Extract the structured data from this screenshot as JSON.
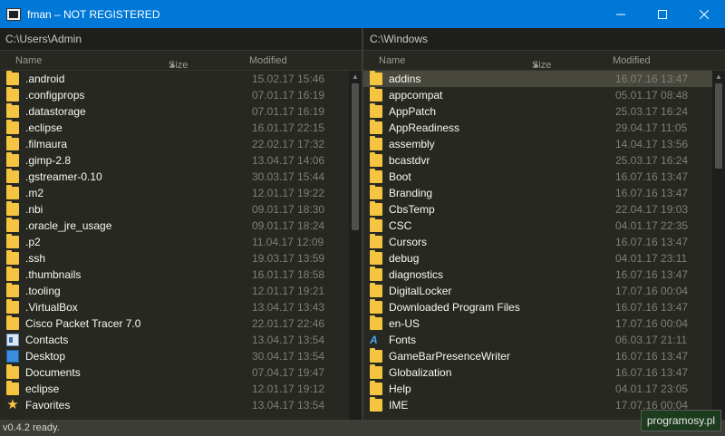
{
  "window": {
    "title": "fman – NOT REGISTERED"
  },
  "left_pane": {
    "path": "C:\\Users\\Admin",
    "columns": {
      "name": "Name",
      "size": "Size",
      "modified": "Modified",
      "sort_indicator": "▲"
    },
    "rows": [
      {
        "name": ".android",
        "modified": "15.02.17 15:46",
        "icon": "folder-icon"
      },
      {
        "name": ".configprops",
        "modified": "07.01.17 16:19",
        "icon": "folder-icon"
      },
      {
        "name": ".datastorage",
        "modified": "07.01.17 16:19",
        "icon": "folder-icon"
      },
      {
        "name": ".eclipse",
        "modified": "16.01.17 22:15",
        "icon": "folder-icon"
      },
      {
        "name": ".filmaura",
        "modified": "22.02.17 17:32",
        "icon": "folder-icon"
      },
      {
        "name": ".gimp-2.8",
        "modified": "13.04.17 14:06",
        "icon": "folder-icon"
      },
      {
        "name": ".gstreamer-0.10",
        "modified": "30.03.17 15:44",
        "icon": "folder-icon"
      },
      {
        "name": ".m2",
        "modified": "12.01.17 19:22",
        "icon": "folder-icon"
      },
      {
        "name": ".nbi",
        "modified": "09.01.17 18:30",
        "icon": "folder-icon"
      },
      {
        "name": ".oracle_jre_usage",
        "modified": "09.01.17 18:24",
        "icon": "folder-icon"
      },
      {
        "name": ".p2",
        "modified": "11.04.17 12:09",
        "icon": "folder-icon"
      },
      {
        "name": ".ssh",
        "modified": "19.03.17 13:59",
        "icon": "folder-icon"
      },
      {
        "name": ".thumbnails",
        "modified": "16.01.17 18:58",
        "icon": "folder-icon"
      },
      {
        "name": ".tooling",
        "modified": "12.01.17 19:21",
        "icon": "folder-icon"
      },
      {
        "name": ".VirtualBox",
        "modified": "13.04.17 13:43",
        "icon": "folder-icon"
      },
      {
        "name": "Cisco Packet Tracer 7.0",
        "modified": "22.01.17 22:46",
        "icon": "folder-icon"
      },
      {
        "name": "Contacts",
        "modified": "13.04.17 13:54",
        "icon": "contacts-icon"
      },
      {
        "name": "Desktop",
        "modified": "30.04.17 13:54",
        "icon": "desktop-icon"
      },
      {
        "name": "Documents",
        "modified": "07.04.17 19:47",
        "icon": "folder-icon"
      },
      {
        "name": "eclipse",
        "modified": "12.01.17 19:12",
        "icon": "folder-icon"
      },
      {
        "name": "Favorites",
        "modified": "13.04.17 13:54",
        "icon": "star-icon"
      }
    ]
  },
  "right_pane": {
    "path": "C:\\Windows",
    "columns": {
      "name": "Name",
      "size": "Size",
      "modified": "Modified",
      "sort_indicator": "▲"
    },
    "selected_row": 0,
    "rows": [
      {
        "name": "addins",
        "modified": "16.07.16 13:47",
        "icon": "folder-icon"
      },
      {
        "name": "appcompat",
        "modified": "05.01.17 08:48",
        "icon": "folder-icon"
      },
      {
        "name": "AppPatch",
        "modified": "25.03.17 16:24",
        "icon": "folder-icon"
      },
      {
        "name": "AppReadiness",
        "modified": "29.04.17 11:05",
        "icon": "folder-icon"
      },
      {
        "name": "assembly",
        "modified": "14.04.17 13:56",
        "icon": "folder-icon"
      },
      {
        "name": "bcastdvr",
        "modified": "25.03.17 16:24",
        "icon": "folder-icon"
      },
      {
        "name": "Boot",
        "modified": "16.07.16 13:47",
        "icon": "folder-icon"
      },
      {
        "name": "Branding",
        "modified": "16.07.16 13:47",
        "icon": "folder-icon"
      },
      {
        "name": "CbsTemp",
        "modified": "22.04.17 19:03",
        "icon": "folder-icon"
      },
      {
        "name": "CSC",
        "modified": "04.01.17 22:35",
        "icon": "folder-icon"
      },
      {
        "name": "Cursors",
        "modified": "16.07.16 13:47",
        "icon": "folder-icon"
      },
      {
        "name": "debug",
        "modified": "04.01.17 23:11",
        "icon": "folder-icon"
      },
      {
        "name": "diagnostics",
        "modified": "16.07.16 13:47",
        "icon": "folder-icon"
      },
      {
        "name": "DigitalLocker",
        "modified": "17.07.16 00:04",
        "icon": "folder-icon"
      },
      {
        "name": "Downloaded Program Files",
        "modified": "16.07.16 13:47",
        "icon": "folder-icon"
      },
      {
        "name": "en-US",
        "modified": "17.07.16 00:04",
        "icon": "folder-icon"
      },
      {
        "name": "Fonts",
        "modified": "06.03.17 21:11",
        "icon": "fonts-icon"
      },
      {
        "name": "GameBarPresenceWriter",
        "modified": "16.07.16 13:47",
        "icon": "folder-icon"
      },
      {
        "name": "Globalization",
        "modified": "16.07.16 13:47",
        "icon": "folder-icon"
      },
      {
        "name": "Help",
        "modified": "04.01.17 23:05",
        "icon": "folder-icon"
      },
      {
        "name": "IME",
        "modified": "17.07.16 00:04",
        "icon": "folder-icon"
      }
    ]
  },
  "statusbar": {
    "text": "v0.4.2 ready."
  },
  "watermark": {
    "text": "programosy.pl"
  },
  "colors": {
    "titlebar": "#0078d7",
    "background": "#272822",
    "folder": "#f5c542",
    "selection": "#49483e",
    "date_text": "#7f7f78"
  }
}
